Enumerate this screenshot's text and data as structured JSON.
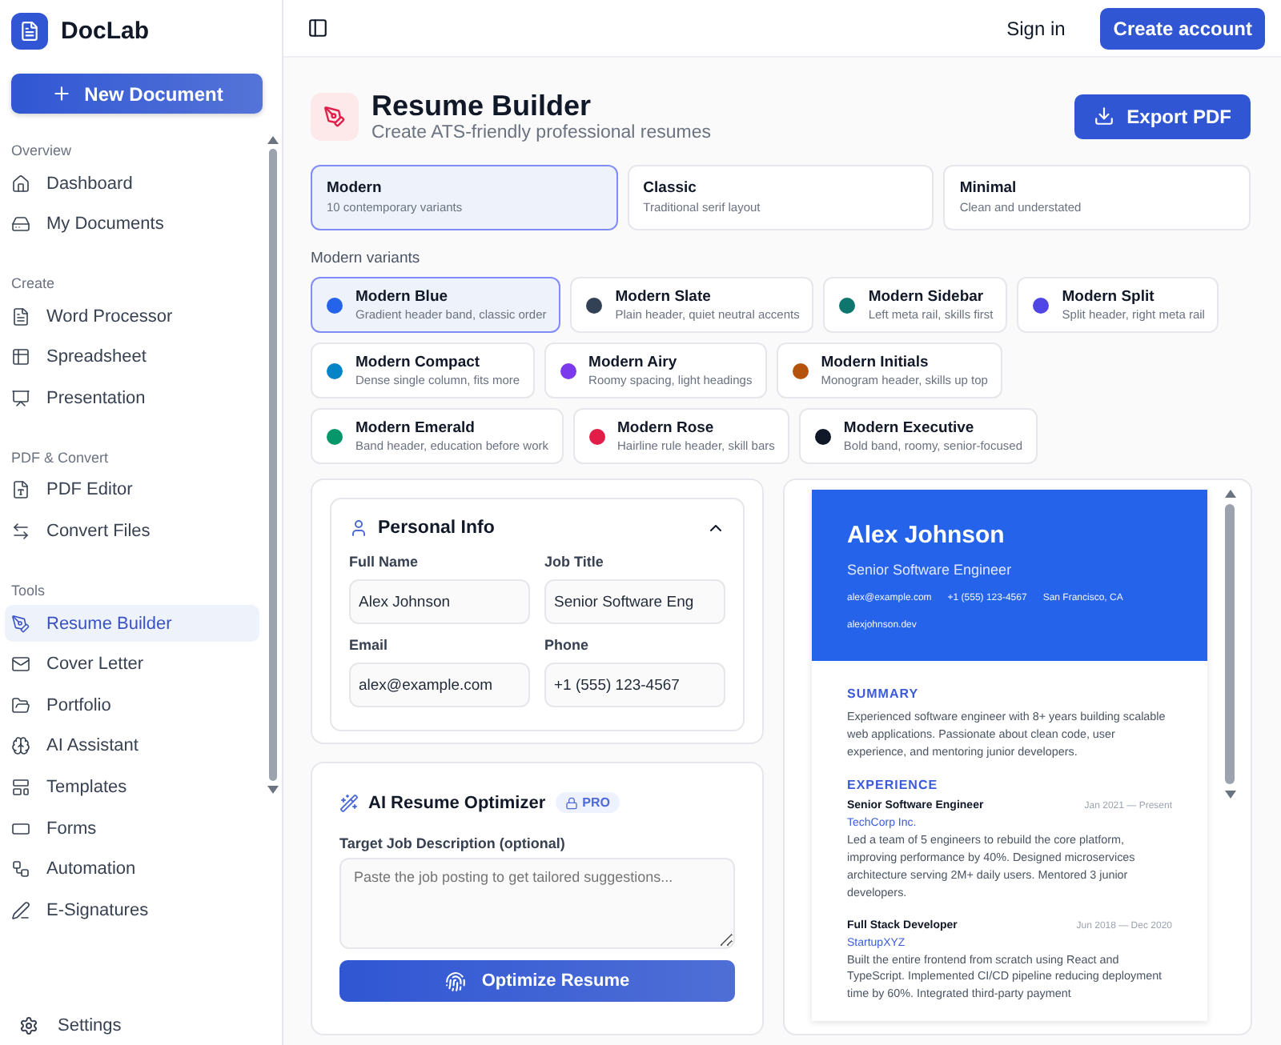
{
  "app": {
    "name": "DocLab"
  },
  "sidebar": {
    "new_button": "New Document",
    "sections": [
      {
        "title": "Overview",
        "items": [
          {
            "label": "Dashboard",
            "selected": false
          },
          {
            "label": "My Documents",
            "selected": false
          }
        ]
      },
      {
        "title": "Create",
        "items": [
          {
            "label": "Word Processor",
            "selected": false
          },
          {
            "label": "Spreadsheet",
            "selected": false
          },
          {
            "label": "Presentation",
            "selected": false
          }
        ]
      },
      {
        "title": "PDF & Convert",
        "items": [
          {
            "label": "PDF Editor",
            "selected": false
          },
          {
            "label": "Convert Files",
            "selected": false
          }
        ]
      },
      {
        "title": "Tools",
        "items": [
          {
            "label": "Resume Builder",
            "selected": true
          },
          {
            "label": "Cover Letter",
            "selected": false
          },
          {
            "label": "Portfolio",
            "selected": false
          },
          {
            "label": "AI Assistant",
            "selected": false
          },
          {
            "label": "Templates",
            "selected": false
          },
          {
            "label": "Forms",
            "selected": false
          },
          {
            "label": "Automation",
            "selected": false
          },
          {
            "label": "E-Signatures",
            "selected": false
          }
        ]
      }
    ],
    "settings": "Settings"
  },
  "topbar": {
    "sign_in": "Sign in",
    "create_account": "Create account"
  },
  "header": {
    "title": "Resume Builder",
    "subtitle": "Create ATS-friendly professional resumes",
    "export_button": "Export PDF"
  },
  "styles": [
    {
      "name": "Modern",
      "description": "10 contemporary variants",
      "selected": true
    },
    {
      "name": "Classic",
      "description": "Traditional serif layout",
      "selected": false
    },
    {
      "name": "Minimal",
      "description": "Clean and understated",
      "selected": false
    }
  ],
  "variants_label": "Modern variants",
  "variant_rows": [
    [
      {
        "name": "Modern Blue",
        "description": "Gradient header band, classic order",
        "color": "#2563eb",
        "selected": true
      },
      {
        "name": "Modern Slate",
        "description": "Plain header, quiet neutral accents",
        "color": "#334155",
        "selected": false
      },
      {
        "name": "Modern Sidebar",
        "description": "Left meta rail, skills first",
        "color": "#0f766e",
        "selected": false
      },
      {
        "name": "Modern Split",
        "description": "Split header, right meta rail",
        "color": "#4f46e5",
        "selected": false
      }
    ],
    [
      {
        "name": "Modern Compact",
        "description": "Dense single column, fits more",
        "color": "#0284c7",
        "selected": false
      },
      {
        "name": "Modern Airy",
        "description": "Roomy spacing, light headings",
        "color": "#7c3aed",
        "selected": false
      },
      {
        "name": "Modern Initials",
        "description": "Monogram header, skills up top",
        "color": "#b45309",
        "selected": false
      }
    ],
    [
      {
        "name": "Modern Emerald",
        "description": "Band header, education before work",
        "color": "#059669",
        "selected": false
      },
      {
        "name": "Modern Rose",
        "description": "Hairline rule header, skill bars",
        "color": "#e11d48",
        "selected": false
      },
      {
        "name": "Modern Executive",
        "description": "Bold band, roomy, senior-focused",
        "color": "#111827",
        "selected": false
      }
    ]
  ],
  "personal_info": {
    "title": "Personal Info",
    "expanded": true,
    "fields": [
      {
        "label": "Full Name",
        "value": "Alex Johnson"
      },
      {
        "label": "Job Title",
        "value": "Senior Software Eng"
      },
      {
        "label": "Email",
        "value": "alex@example.com"
      },
      {
        "label": "Phone",
        "value": "+1 (555) 123-4567"
      }
    ]
  },
  "optimizer": {
    "title": "AI Resume Optimizer",
    "badge": "PRO",
    "field_label": "Target Job Description (optional)",
    "placeholder": "Paste the job posting to get tailored suggestions...",
    "button": "Optimize Resume"
  },
  "preview": {
    "name": "Alex Johnson",
    "role": "Senior Software Engineer",
    "contacts": [
      "alex@example.com",
      "+1 (555) 123-4567",
      "San Francisco, CA",
      "alexjohnson.dev"
    ],
    "summary_heading": "SUMMARY",
    "summary": "Experienced software engineer with 8+ years building scalable web applications. Passionate about clean code, user experience, and mentoring junior developers.",
    "experience_heading": "EXPERIENCE",
    "jobs": [
      {
        "title": "Senior Software Engineer",
        "dates": "Jan 2021 — Present",
        "company": "TechCorp Inc.",
        "text": "Led a team of 5 engineers to rebuild the core platform, improving performance by 40%. Designed microservices architecture serving 2M+ daily users. Mentored 3 junior developers."
      },
      {
        "title": "Full Stack Developer",
        "dates": "Jun 2018 — Dec 2020",
        "company": "StartupXYZ",
        "text": "Built the entire frontend from scratch using React and TypeScript. Implemented CI/CD pipeline reducing deployment time by 60%. Integrated third-party payment"
      }
    ]
  }
}
